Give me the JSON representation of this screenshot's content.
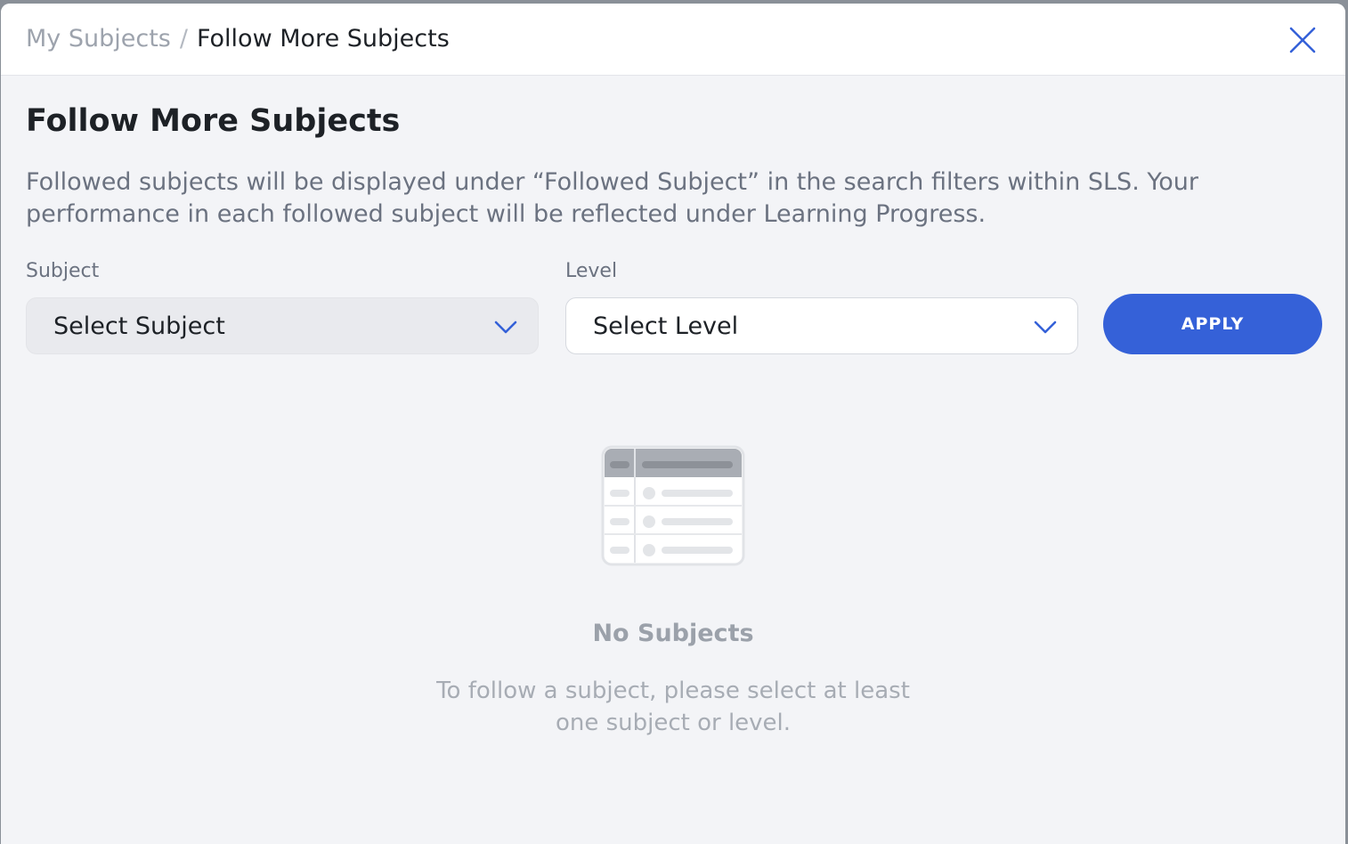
{
  "header": {
    "breadcrumb_parent": "My Subjects",
    "breadcrumb_separator": "/",
    "breadcrumb_current": "Follow More Subjects",
    "close_icon": "close-icon"
  },
  "main": {
    "title": "Follow More Subjects",
    "description": "Followed subjects will be displayed under “Followed Subject” in the search filters within SLS. Your performance in each followed subject will be reflected under Learning Progress."
  },
  "filters": {
    "subject_label": "Subject",
    "subject_value": "Select Subject",
    "level_label": "Level",
    "level_value": "Select Level",
    "apply_label": "APPLY",
    "chevron_icon": "chevron-down-icon"
  },
  "empty_state": {
    "icon": "empty-table-icon",
    "title": "No Subjects",
    "message": "To follow a subject, please select at least one subject or level."
  },
  "colors": {
    "accent": "#3561d8",
    "page_background": "#f3f4f7",
    "header_background": "#ffffff",
    "title_text": "#1d2126",
    "muted_text": "#6b7280"
  }
}
